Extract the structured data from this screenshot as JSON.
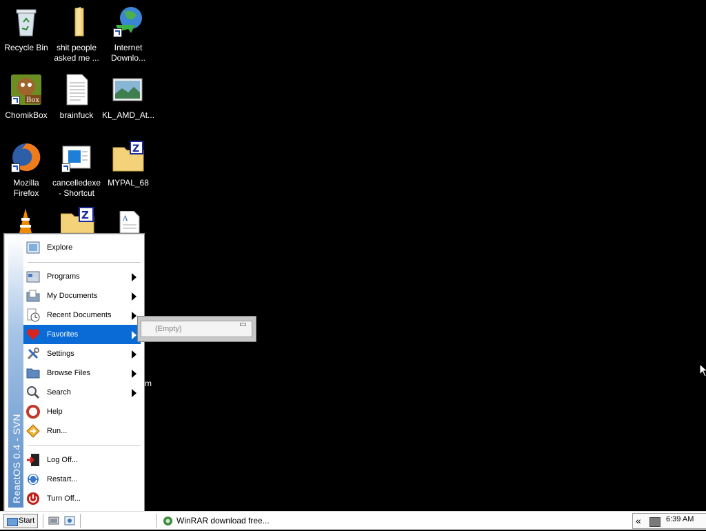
{
  "desktop": {
    "icons": [
      {
        "label_line1": "Recycle Bin",
        "label_line2": "",
        "icon": "recycle-bin-icon"
      },
      {
        "label_line1": "shit people",
        "label_line2": "asked me ...",
        "icon": "folder-icon"
      },
      {
        "label_line1": "Internet",
        "label_line2": "Downlo...",
        "icon": "internet-download-manager-icon"
      },
      {
        "label_line1": "ChomikBox",
        "label_line2": "",
        "icon": "chomikbox-icon"
      },
      {
        "label_line1": "brainfuck",
        "label_line2": "",
        "icon": "text-file-icon"
      },
      {
        "label_line1": "KL_AMD_At...",
        "label_line2": "",
        "icon": "image-file-icon"
      },
      {
        "label_line1": "Mozilla",
        "label_line2": "Firefox",
        "icon": "firefox-icon"
      },
      {
        "label_line1": "cancelledexe",
        "label_line2": "- Shortcut",
        "icon": "shortcut-window-icon"
      },
      {
        "label_line1": "MYPAL_68",
        "label_line2": "",
        "icon": "zip-folder-icon"
      }
    ],
    "partial_label": "m"
  },
  "start_menu": {
    "banner": "ReactOS 0.4 - SVN",
    "items": [
      {
        "label": "Explore",
        "icon": "explore-icon",
        "submenu": false
      },
      {
        "label": "Programs",
        "icon": "programs-icon",
        "submenu": true
      },
      {
        "label": "My Documents",
        "icon": "my-documents-icon",
        "submenu": true
      },
      {
        "label": "Recent Documents",
        "icon": "recent-documents-icon",
        "submenu": true
      },
      {
        "label": "Favorites",
        "icon": "favorites-icon",
        "submenu": true,
        "selected": true
      },
      {
        "label": "Settings",
        "icon": "settings-icon",
        "submenu": true
      },
      {
        "label": "Browse Files",
        "icon": "browse-files-icon",
        "submenu": true
      },
      {
        "label": "Search",
        "icon": "search-icon",
        "submenu": true
      },
      {
        "label": "Help",
        "icon": "help-icon",
        "submenu": false
      },
      {
        "label": "Run...",
        "icon": "run-icon",
        "submenu": false
      },
      {
        "label": "Log Off...",
        "icon": "log-off-icon",
        "submenu": false
      },
      {
        "label": "Restart...",
        "icon": "restart-icon",
        "submenu": false
      },
      {
        "label": "Turn Off...",
        "icon": "turn-off-icon",
        "submenu": false
      }
    ]
  },
  "favorites_submenu": {
    "empty_label": "(Empty)"
  },
  "taskbar": {
    "start_label": "Start",
    "task_label": "WinRAR download free...",
    "tray_chevron": "«",
    "clock": "6:39 AM"
  },
  "colors": {
    "desktop": "#000000",
    "selection": "#0a6bd6",
    "banner": "#5a8ec8"
  }
}
